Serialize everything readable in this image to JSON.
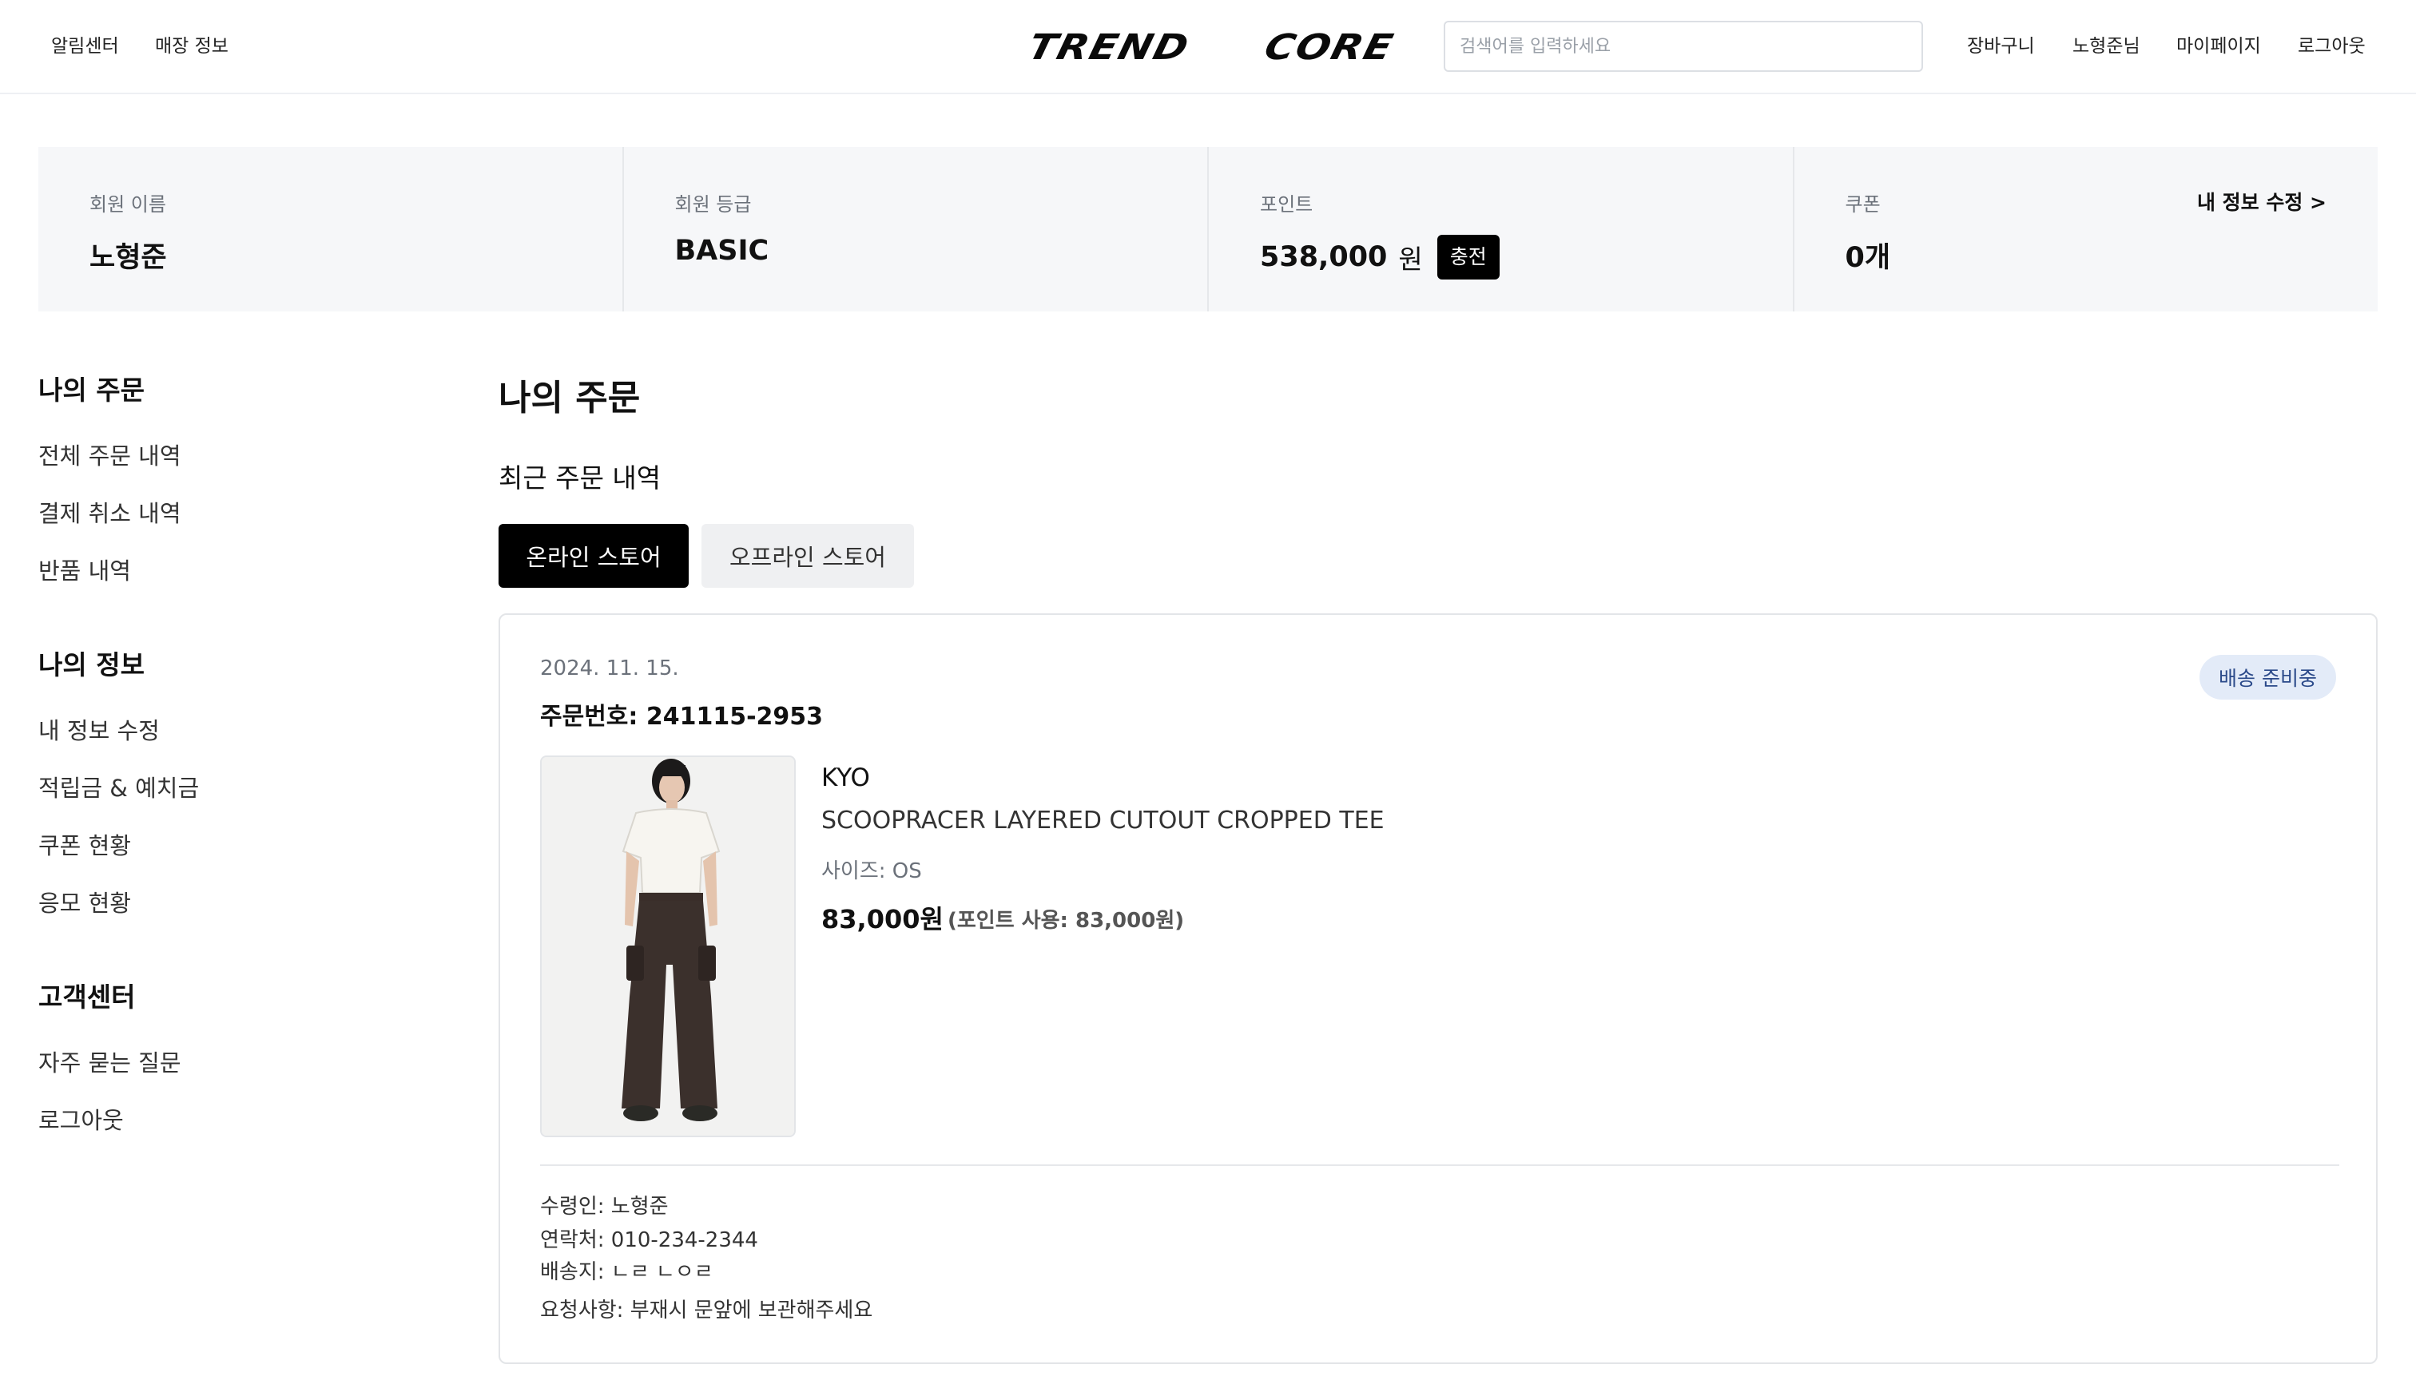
{
  "header": {
    "left_links": [
      "알림센터",
      "매장 정보"
    ],
    "logo": [
      "TREND",
      "CORE"
    ],
    "search_placeholder": "검색어를 입력하세요",
    "right_links": [
      "장바구니",
      "노형준님",
      "마이페이지",
      "로그아웃"
    ]
  },
  "summary": {
    "name_label": "회원 이름",
    "name_value": "노형준",
    "grade_label": "회원 등급",
    "grade_value": "BASIC",
    "point_label": "포인트",
    "point_value": "538,000",
    "point_unit": "원",
    "charge_button": "충전",
    "coupon_label": "쿠폰",
    "coupon_value": "0개",
    "edit_link": "내 정보 수정 >"
  },
  "sidebar": {
    "sections": [
      {
        "title": "나의 주문",
        "items": [
          "전체 주문 내역",
          "결제 취소 내역",
          "반품 내역"
        ]
      },
      {
        "title": "나의 정보",
        "items": [
          "내 정보 수정",
          "적립금 & 예치금",
          "쿠폰 현황",
          "응모 현황"
        ]
      },
      {
        "title": "고객센터",
        "items": [
          "자주 묻는 질문",
          "로그아웃"
        ]
      }
    ]
  },
  "main": {
    "title": "나의 주문",
    "subtitle": "최근 주문 내역",
    "tabs": [
      "온라인 스토어",
      "오프라인 스토어"
    ],
    "active_tab": 0,
    "order": {
      "date": "2024. 11. 15.",
      "number": "주문번호: 241115-2953",
      "status": "배송 준비중",
      "brand": "KYO",
      "product_name": "SCOOPRACER LAYERED CUTOUT CROPPED TEE",
      "size": "사이즈: OS",
      "price": "83,000원",
      "points_used": "(포인트 사용: 83,000원)",
      "recipient": "수령인: 노형준",
      "contact": "연락처: 010-234-2344",
      "address": "배송지: ㄴㄹ ㄴㅇㄹ",
      "request": "요청사항: 부재시 문앞에 보관해주세요"
    }
  }
}
